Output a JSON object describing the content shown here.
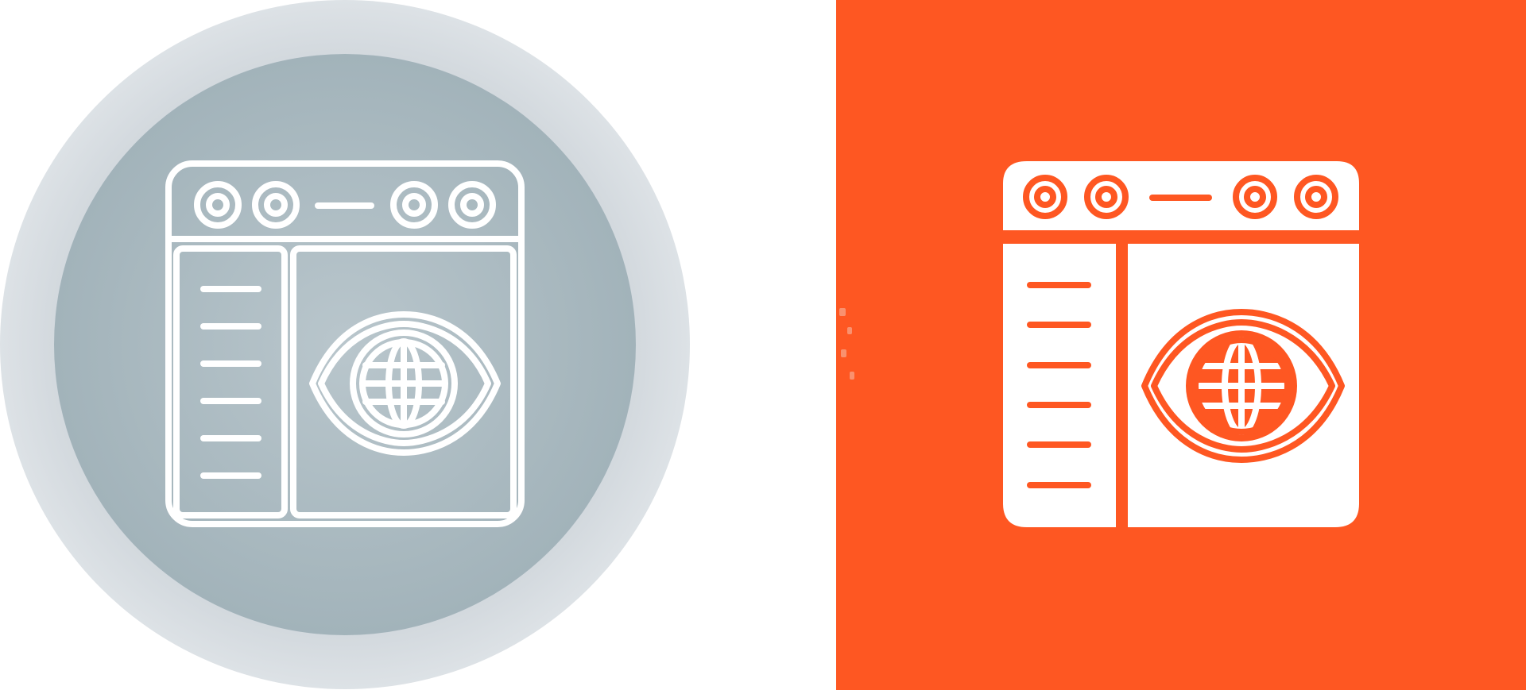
{
  "panels": [
    {
      "style": "outline",
      "icon": "browser-eye-globe-icon",
      "background": "#ffffff",
      "outer_circle": "#d0d6db",
      "inner_circle": "#a4b5bc",
      "stroke": "#ffffff"
    },
    {
      "style": "glyph",
      "icon": "browser-eye-globe-icon",
      "background": "#fe5722",
      "fill": "#ffffff",
      "stroke": "#fe5722"
    }
  ]
}
